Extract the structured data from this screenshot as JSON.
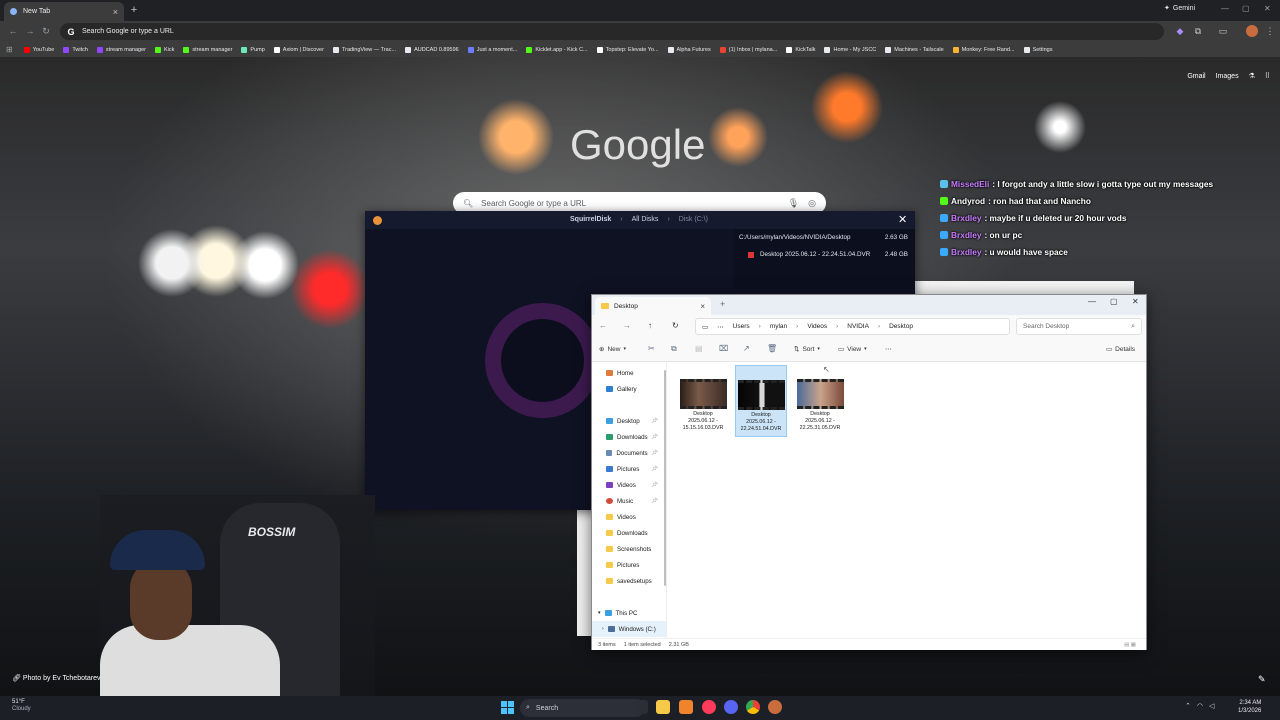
{
  "browser": {
    "tab_title": "New Tab",
    "omnibox_placeholder": "Search Google or type a URL",
    "gemini_label": "Gemini",
    "bookmarks": [
      {
        "label": "YouTube",
        "color": "#ff0000"
      },
      {
        "label": "Twitch",
        "color": "#9146ff"
      },
      {
        "label": "stream manager",
        "color": "#9146ff"
      },
      {
        "label": "Kick",
        "color": "#53fc18"
      },
      {
        "label": "stream manager",
        "color": "#53fc18"
      },
      {
        "label": "Pump",
        "color": "#6ee7b7"
      },
      {
        "label": "Axiom | Discover",
        "color": "#ffffff"
      },
      {
        "label": "TradingView — Trac...",
        "color": "#e8eaed"
      },
      {
        "label": "AUDCAD 0.89596",
        "color": "#e8eaed"
      },
      {
        "label": "Just a moment...",
        "color": "#6e7bff"
      },
      {
        "label": "Kicklet.app - Kick C...",
        "color": "#53fc18"
      },
      {
        "label": "Topstep: Elevate Yo...",
        "color": "#ffffff"
      },
      {
        "label": "Alpha Futures",
        "color": "#e8eaed"
      },
      {
        "label": "(1) Inbox | mylana...",
        "color": "#ea4335"
      },
      {
        "label": "KickTalk",
        "color": "#ffffff"
      },
      {
        "label": "Home - My JSCC",
        "color": "#e8eaed"
      },
      {
        "label": "Machines - Tailscale",
        "color": "#e8eaed"
      },
      {
        "label": "Monkey: Free Rand...",
        "color": "#f9b233"
      },
      {
        "label": "Settings",
        "color": "#e8eaed"
      }
    ]
  },
  "ntp": {
    "links": {
      "gmail": "Gmail",
      "images": "Images"
    },
    "logo": "Google",
    "search_placeholder": "Search Google or type a URL",
    "photo_credit": "Photo by Ev Tchebotarev"
  },
  "chat": [
    {
      "user": "MissedEli",
      "msg": ": I forgot andy a little slow i gotta type out my messages",
      "color": "#c77dff",
      "badge": "#5bc0eb"
    },
    {
      "user": "Andyrod",
      "msg": ": ron had that and Nancho",
      "color": "#ffffff",
      "badge": "#53fc18"
    },
    {
      "user": "Brxdley",
      "msg": ": maybe if u deleted ur 20 hour vods",
      "color": "#c77dff",
      "badge": "#3ba9ff"
    },
    {
      "user": "Brxdley",
      "msg": ": on ur pc",
      "color": "#c77dff",
      "badge": "#3ba9ff"
    },
    {
      "user": "Brxdley",
      "msg": ": u would have space",
      "color": "#c77dff",
      "badge": "#3ba9ff"
    }
  ],
  "squirreldisk": {
    "crumbs": [
      "SquirrelDisk",
      "All Disks",
      "Disk (C:\\)"
    ],
    "panel": {
      "path": "C:/Users/mylan/Videos/NVIDIA/Desktop",
      "path_size": "2.63 GB",
      "file_name": "Desktop 2025.06.12 - 22.24.51.04.DVR",
      "file_size": "2.48 GB"
    }
  },
  "explorer": {
    "tab_title": "Desktop",
    "path": [
      "Users",
      "mylan",
      "Videos",
      "NVIDIA",
      "Desktop"
    ],
    "search_placeholder": "Search Desktop",
    "cmd": {
      "new": "New",
      "sort": "Sort",
      "view": "View",
      "details": "Details"
    },
    "nav": {
      "home": "Home",
      "gallery": "Gallery",
      "desktop": "Desktop",
      "downloads": "Downloads",
      "documents": "Documents",
      "pictures": "Pictures",
      "videos": "Videos",
      "music": "Music",
      "videos2": "Videos",
      "downloads2": "Downloads",
      "screenshots": "Screenshots",
      "pictures2": "Pictures",
      "savedsetups": "savedsetups",
      "thispc": "This PC",
      "windows": "Windows (C:)"
    },
    "files": [
      {
        "line1": "Desktop",
        "line2": "2025.06.12 -",
        "line3": "15.15.16.03.DVR",
        "selected": false
      },
      {
        "line1": "Desktop",
        "line2": "2025.06.12 -",
        "line3": "22.24.51.04.DVR",
        "selected": true
      },
      {
        "line1": "Desktop",
        "line2": "2025.06.12 -",
        "line3": "22.25.31.05.DVR",
        "selected": false
      }
    ],
    "status": {
      "items": "3 items",
      "selected": "1 item selected",
      "size": "2.31 GB"
    }
  },
  "webcam": {
    "chair_logo": "BOSSIM"
  },
  "taskbar": {
    "weather_temp": "51°F",
    "weather_desc": "Cloudy",
    "search_label": "Search",
    "time": "2:34 AM",
    "date": "1/3/2026"
  }
}
